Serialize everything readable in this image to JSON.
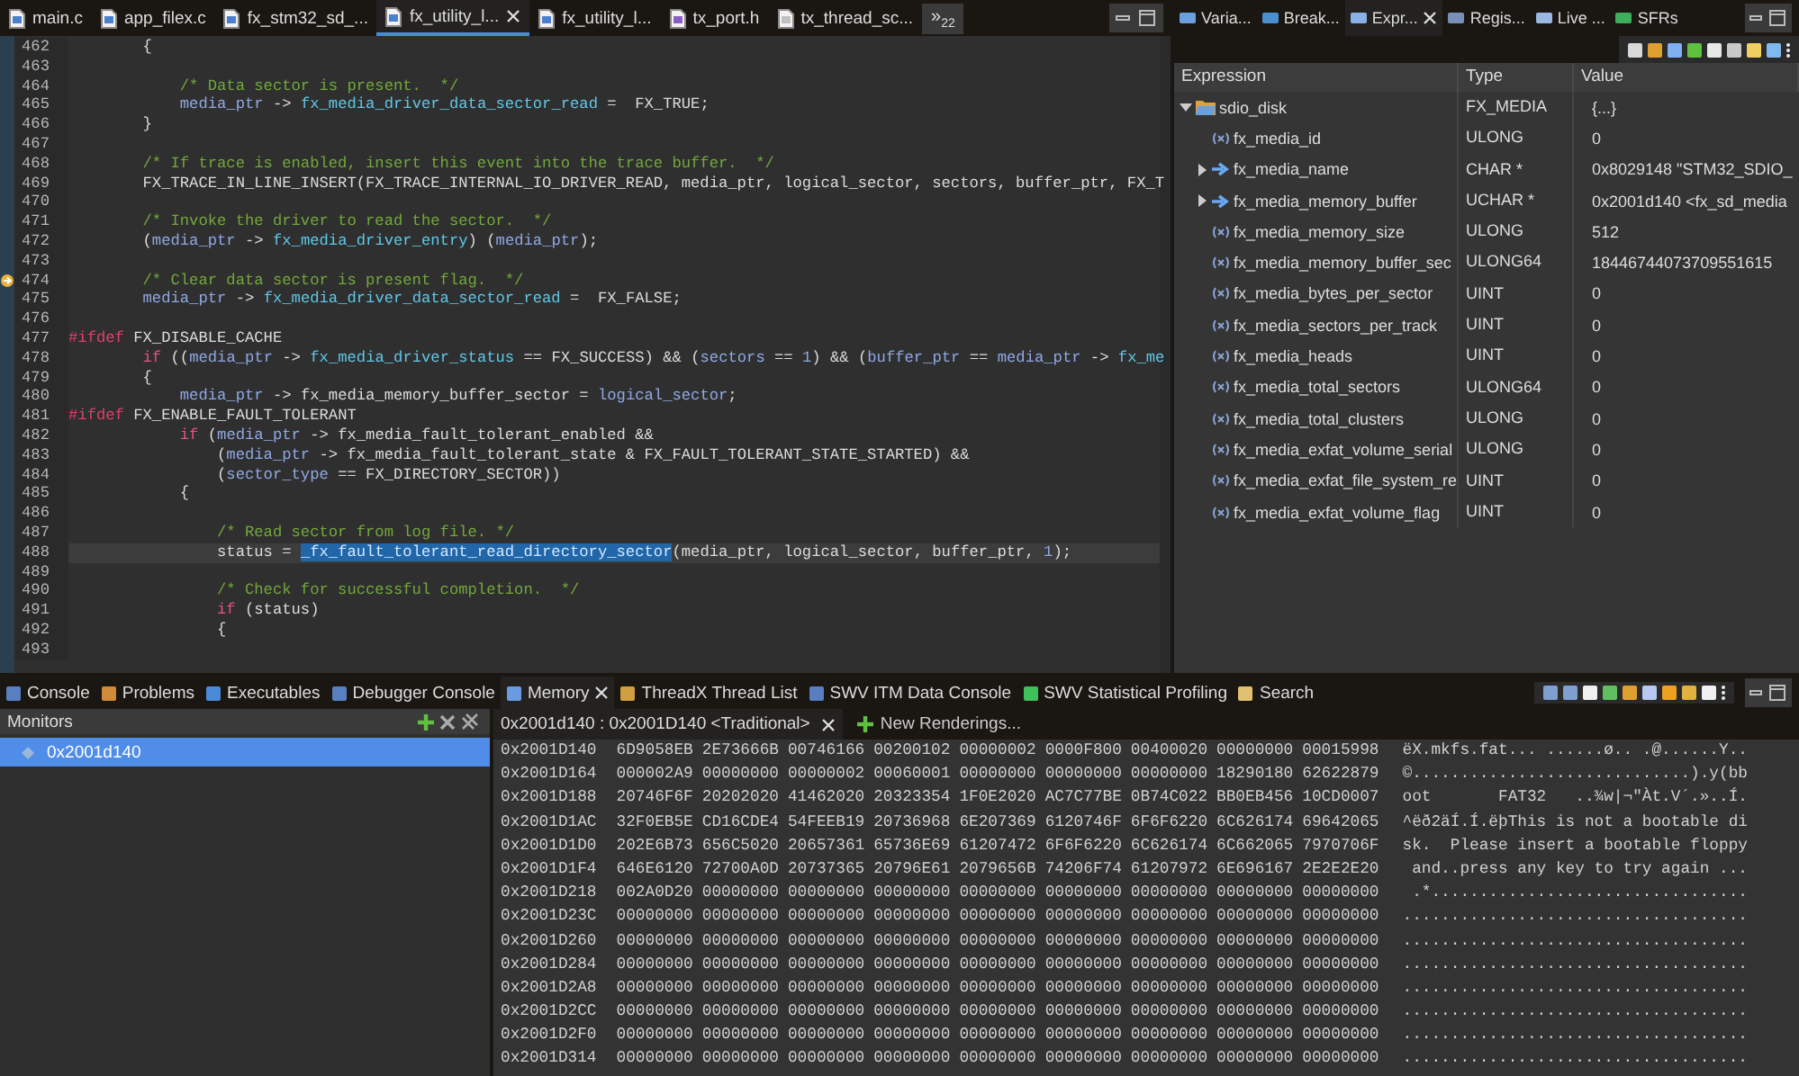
{
  "editor": {
    "tabs": [
      {
        "label": "main.c",
        "kind": "c-source",
        "selected": false
      },
      {
        "label": "app_filex.c",
        "kind": "c-source",
        "selected": false
      },
      {
        "label": "fx_stm32_sd_...",
        "kind": "c-source",
        "selected": false
      },
      {
        "label": "fx_utility_l...",
        "kind": "c-source",
        "selected": true
      },
      {
        "label": "fx_utility_l...",
        "kind": "c-source",
        "selected": false
      },
      {
        "label": "tx_port.h",
        "kind": "c-header",
        "selected": false
      },
      {
        "label": "tx_thread_sc...",
        "kind": "asm-source",
        "selected": false
      }
    ],
    "overflow": {
      "label": "»",
      "count": "22"
    },
    "lines": [
      {
        "number": "462",
        "kind": "plain",
        "segments": [
          {
            "kind": "plain",
            "text": "        {"
          }
        ]
      },
      {
        "number": "463",
        "kind": "plain"
      },
      {
        "number": "464",
        "kind": "plain",
        "segments": [
          {
            "kind": "comment",
            "text": "            /* Data sector is present.  */"
          }
        ]
      },
      {
        "number": "465",
        "kind": "plain",
        "segments": [
          {
            "kind": "var",
            "text": "            media_ptr"
          },
          {
            "kind": "plain",
            "text": " -> "
          },
          {
            "kind": "field",
            "text": "fx_media_driver_data_sector_read"
          },
          {
            "kind": "plain",
            "text": " =  FX_TRUE;"
          }
        ]
      },
      {
        "number": "466",
        "kind": "plain",
        "segments": [
          {
            "kind": "plain",
            "text": "        }"
          }
        ]
      },
      {
        "number": "467",
        "kind": "plain"
      },
      {
        "number": "468",
        "kind": "plain",
        "segments": [
          {
            "kind": "comment",
            "text": "        /* If trace is enabled, insert this event into the trace buffer.  */"
          }
        ]
      },
      {
        "number": "469",
        "kind": "plain",
        "segments": [
          {
            "kind": "plain",
            "text": "        FX_TRACE_IN_LINE_INSERT(FX_TRACE_INTERNAL_IO_DRIVER_READ, media_ptr, logical_sector, sectors, buffer_ptr, FX_T"
          }
        ]
      },
      {
        "number": "470",
        "kind": "plain"
      },
      {
        "number": "471",
        "kind": "plain",
        "segments": [
          {
            "kind": "comment",
            "text": "        /* Invoke the driver to read the sector.  */"
          }
        ]
      },
      {
        "number": "472",
        "kind": "plain",
        "segments": [
          {
            "kind": "plain",
            "text": "        ("
          },
          {
            "kind": "var",
            "text": "media_ptr"
          },
          {
            "kind": "plain",
            "text": " -> "
          },
          {
            "kind": "field",
            "text": "fx_media_driver_entry"
          },
          {
            "kind": "plain",
            "text": ") ("
          },
          {
            "kind": "var",
            "text": "media_ptr"
          },
          {
            "kind": "plain",
            "text": ");"
          }
        ]
      },
      {
        "number": "473",
        "kind": "plain"
      },
      {
        "number": "474",
        "kind": "pointer",
        "segments": [
          {
            "kind": "comment",
            "text": "        /* Clear data sector is present flag.  */"
          }
        ]
      },
      {
        "number": "475",
        "kind": "plain",
        "segments": [
          {
            "kind": "var",
            "text": "        media_ptr"
          },
          {
            "kind": "plain",
            "text": " -> "
          },
          {
            "kind": "field",
            "text": "fx_media_driver_data_sector_read"
          },
          {
            "kind": "plain",
            "text": " =  FX_FALSE;"
          }
        ]
      },
      {
        "number": "476",
        "kind": "plain"
      },
      {
        "number": "477",
        "kind": "plain",
        "segments": [
          {
            "kind": "directive",
            "text": "#ifdef"
          },
          {
            "kind": "plain",
            "text": " FX_DISABLE_CACHE"
          }
        ]
      },
      {
        "number": "478",
        "kind": "plain",
        "segments": [
          {
            "kind": "keyword",
            "text": "        if"
          },
          {
            "kind": "plain",
            "text": " (("
          },
          {
            "kind": "var",
            "text": "media_ptr"
          },
          {
            "kind": "plain",
            "text": " -> "
          },
          {
            "kind": "field",
            "text": "fx_media_driver_status"
          },
          {
            "kind": "plain",
            "text": " == FX_SUCCESS) && ("
          },
          {
            "kind": "var",
            "text": "sectors"
          },
          {
            "kind": "plain",
            "text": " == "
          },
          {
            "kind": "number",
            "text": "1"
          },
          {
            "kind": "plain",
            "text": ") && ("
          },
          {
            "kind": "var",
            "text": "buffer_ptr"
          },
          {
            "kind": "plain",
            "text": " == "
          },
          {
            "kind": "var",
            "text": "media_ptr"
          },
          {
            "kind": "plain",
            "text": " -> "
          },
          {
            "kind": "field",
            "text": "fx_me"
          }
        ]
      },
      {
        "number": "479",
        "kind": "plain",
        "segments": [
          {
            "kind": "plain",
            "text": "        {"
          }
        ]
      },
      {
        "number": "480",
        "kind": "plain",
        "segments": [
          {
            "kind": "var",
            "text": "            media_ptr"
          },
          {
            "kind": "plain",
            "text": " -> fx_media_memory_buffer_sector = "
          },
          {
            "kind": "var",
            "text": "logical_sector"
          },
          {
            "kind": "plain",
            "text": ";"
          }
        ]
      },
      {
        "number": "481",
        "kind": "plain",
        "segments": [
          {
            "kind": "directive",
            "text": "#ifdef"
          },
          {
            "kind": "plain",
            "text": " FX_ENABLE_FAULT_TOLERANT"
          }
        ]
      },
      {
        "number": "482",
        "kind": "plain",
        "segments": [
          {
            "kind": "keyword",
            "text": "            if"
          },
          {
            "kind": "plain",
            "text": " ("
          },
          {
            "kind": "var",
            "text": "media_ptr"
          },
          {
            "kind": "plain",
            "text": " -> fx_media_fault_tolerant_enabled &&"
          }
        ]
      },
      {
        "number": "483",
        "kind": "plain",
        "segments": [
          {
            "kind": "plain",
            "text": "                ("
          },
          {
            "kind": "var",
            "text": "media_ptr"
          },
          {
            "kind": "plain",
            "text": " -> fx_media_fault_tolerant_state & FX_FAULT_TOLERANT_STATE_STARTED) &&"
          }
        ]
      },
      {
        "number": "484",
        "kind": "plain",
        "segments": [
          {
            "kind": "plain",
            "text": "                ("
          },
          {
            "kind": "var",
            "text": "sector_type"
          },
          {
            "kind": "plain",
            "text": " == FX_DIRECTORY_SECTOR))"
          }
        ]
      },
      {
        "number": "485",
        "kind": "plain",
        "segments": [
          {
            "kind": "plain",
            "text": "            {"
          }
        ]
      },
      {
        "number": "486",
        "kind": "plain"
      },
      {
        "number": "487",
        "kind": "plain",
        "segments": [
          {
            "kind": "comment",
            "text": "                /* Read sector from log file. */"
          }
        ]
      },
      {
        "number": "488",
        "kind": "current",
        "segments": [
          {
            "kind": "plain",
            "text": "                status = "
          },
          {
            "kind": "selection",
            "text": "_fx_fault_tolerant_read_directory_sector"
          },
          {
            "kind": "plain",
            "text": "(media_ptr, logical_sector, buffer_ptr, "
          },
          {
            "kind": "number",
            "text": "1"
          },
          {
            "kind": "plain",
            "text": ");"
          }
        ]
      },
      {
        "number": "489",
        "kind": "plain"
      },
      {
        "number": "490",
        "kind": "plain",
        "segments": [
          {
            "kind": "comment",
            "text": "                /* Check for successful completion.  */"
          }
        ]
      },
      {
        "number": "491",
        "kind": "plain",
        "segments": [
          {
            "kind": "keyword",
            "text": "                if"
          },
          {
            "kind": "plain",
            "text": " (status)"
          }
        ]
      },
      {
        "number": "492",
        "kind": "plain",
        "segments": [
          {
            "kind": "plain",
            "text": "                {"
          }
        ]
      },
      {
        "number": "493",
        "kind": "plain"
      }
    ]
  },
  "debug_panel": {
    "tabs": [
      {
        "label": "Varia...",
        "kind": "variables",
        "selected": false
      },
      {
        "label": "Break...",
        "kind": "breakpoints",
        "selected": false
      },
      {
        "label": "Expr...",
        "kind": "expressions",
        "selected": true
      },
      {
        "label": "Regis...",
        "kind": "registers",
        "selected": false
      },
      {
        "label": "Live ...",
        "kind": "live",
        "selected": false
      },
      {
        "label": "SFRs",
        "kind": "sfrs",
        "selected": false
      }
    ],
    "columns": [
      "Expression",
      "Type",
      "Value"
    ],
    "rows": [
      {
        "name": "sdio_disk",
        "type": "FX_MEDIA",
        "value": "{...}",
        "kind": "struct",
        "expanded": true,
        "children": [
          {
            "name": "fx_media_id",
            "type": "ULONG",
            "value": "0",
            "kind": "field"
          },
          {
            "name": "fx_media_name",
            "type": "CHAR *",
            "value": "0x8029148 \"STM32_SDIO_",
            "kind": "pointer",
            "expanded": false
          },
          {
            "name": "fx_media_memory_buffer",
            "type": "UCHAR *",
            "value": "0x2001d140 <fx_sd_media",
            "kind": "pointer",
            "expanded": false
          },
          {
            "name": "fx_media_memory_size",
            "type": "ULONG",
            "value": "512",
            "kind": "field"
          },
          {
            "name": "fx_media_memory_buffer_sec",
            "type": "ULONG64",
            "value": "18446744073709551615",
            "kind": "field"
          },
          {
            "name": "fx_media_bytes_per_sector",
            "type": "UINT",
            "value": "0",
            "kind": "field"
          },
          {
            "name": "fx_media_sectors_per_track",
            "type": "UINT",
            "value": "0",
            "kind": "field"
          },
          {
            "name": "fx_media_heads",
            "type": "UINT",
            "value": "0",
            "kind": "field"
          },
          {
            "name": "fx_media_total_sectors",
            "type": "ULONG64",
            "value": "0",
            "kind": "field"
          },
          {
            "name": "fx_media_total_clusters",
            "type": "ULONG",
            "value": "0",
            "kind": "field"
          },
          {
            "name": "fx_media_exfat_volume_serial",
            "type": "ULONG",
            "value": "0",
            "kind": "field"
          },
          {
            "name": "fx_media_exfat_file_system_re",
            "type": "UINT",
            "value": "0",
            "kind": "field"
          },
          {
            "name": "fx_media_exfat_volume_flag",
            "type": "UINT",
            "value": "0",
            "kind": "field"
          }
        ]
      }
    ]
  },
  "bottom_panel": {
    "tabs": [
      {
        "label": "Console",
        "kind": "console",
        "selected": false
      },
      {
        "label": "Problems",
        "kind": "problems",
        "selected": false
      },
      {
        "label": "Executables",
        "kind": "executables",
        "selected": false
      },
      {
        "label": "Debugger Console",
        "kind": "console",
        "selected": false
      },
      {
        "label": "Memory",
        "kind": "memory",
        "selected": true
      },
      {
        "label": "ThreadX Thread List",
        "kind": "threads",
        "selected": false
      },
      {
        "label": "SWV ITM Data Console",
        "kind": "console",
        "selected": false
      },
      {
        "label": "SWV Statistical Profiling",
        "kind": "profiling",
        "selected": false
      },
      {
        "label": "Search",
        "kind": "search",
        "selected": false
      }
    ],
    "monitors": {
      "title": "Monitors",
      "items": [
        {
          "label": "0x2001d140",
          "selected": true
        }
      ]
    },
    "renderings": {
      "tabs": [
        {
          "label": "0x2001d140 : 0x2001D140 <Traditional>",
          "selected": true
        }
      ],
      "new_rendering": "New Renderings..."
    },
    "memory_rows": [
      {
        "address": "0x2001D140",
        "words": [
          "6D9058EB",
          "2E73666B",
          "00746166",
          "00200102",
          "00000002",
          "0000F800",
          "00400020",
          "00000000",
          "00015998"
        ],
        "ascii": "ëX.mkfs.fat... ......ø.. .@......Y.."
      },
      {
        "address": "0x2001D164",
        "words": [
          "000002A9",
          "00000000",
          "00000002",
          "00060001",
          "00000000",
          "00000000",
          "00000000",
          "18290180",
          "62622879"
        ],
        "ascii": "©.............................).y(bb"
      },
      {
        "address": "0x2001D188",
        "words": [
          "20746F6F",
          "20202020",
          "41462020",
          "20323354",
          "1F0E2020",
          "AC7C77BE",
          "0B74C022",
          "BB0EB456",
          "10CD0007"
        ],
        "ascii": "oot       FAT32   ..¾w|¬\"Àt.V´.»..Í."
      },
      {
        "address": "0x2001D1AC",
        "words": [
          "32F0EB5E",
          "CD16CDE4",
          "54FEEB19",
          "20736968",
          "6E207369",
          "6120746F",
          "6F6F6220",
          "6C626174",
          "69642065"
        ],
        "ascii": "^ëð2äÍ.Í.ëþThis is not a bootable di"
      },
      {
        "address": "0x2001D1D0",
        "words": [
          "202E6B73",
          "656C5020",
          "20657361",
          "65736E69",
          "61207472",
          "6F6F6220",
          "6C626174",
          "6C662065",
          "7970706F"
        ],
        "ascii": "sk.  Please insert a bootable floppy"
      },
      {
        "address": "0x2001D1F4",
        "words": [
          "646E6120",
          "72700A0D",
          "20737365",
          "20796E61",
          "2079656B",
          "74206F74",
          "61207972",
          "6E696167",
          "2E2E2E20"
        ],
        "ascii": " and..press any key to try again ..."
      },
      {
        "address": "0x2001D218",
        "words": [
          "002A0D20",
          "00000000",
          "00000000",
          "00000000",
          "00000000",
          "00000000",
          "00000000",
          "00000000",
          "00000000"
        ],
        "ascii": " .*................................."
      },
      {
        "address": "0x2001D23C",
        "words": [
          "00000000",
          "00000000",
          "00000000",
          "00000000",
          "00000000",
          "00000000",
          "00000000",
          "00000000",
          "00000000"
        ],
        "ascii": "...................................."
      },
      {
        "address": "0x2001D260",
        "words": [
          "00000000",
          "00000000",
          "00000000",
          "00000000",
          "00000000",
          "00000000",
          "00000000",
          "00000000",
          "00000000"
        ],
        "ascii": "...................................."
      },
      {
        "address": "0x2001D284",
        "words": [
          "00000000",
          "00000000",
          "00000000",
          "00000000",
          "00000000",
          "00000000",
          "00000000",
          "00000000",
          "00000000"
        ],
        "ascii": "...................................."
      },
      {
        "address": "0x2001D2A8",
        "words": [
          "00000000",
          "00000000",
          "00000000",
          "00000000",
          "00000000",
          "00000000",
          "00000000",
          "00000000",
          "00000000"
        ],
        "ascii": "...................................."
      },
      {
        "address": "0x2001D2CC",
        "words": [
          "00000000",
          "00000000",
          "00000000",
          "00000000",
          "00000000",
          "00000000",
          "00000000",
          "00000000",
          "00000000"
        ],
        "ascii": "...................................."
      },
      {
        "address": "0x2001D2F0",
        "words": [
          "00000000",
          "00000000",
          "00000000",
          "00000000",
          "00000000",
          "00000000",
          "00000000",
          "00000000",
          "00000000"
        ],
        "ascii": "...................................."
      },
      {
        "address": "0x2001D314",
        "words": [
          "00000000",
          "00000000",
          "00000000",
          "00000000",
          "00000000",
          "00000000",
          "00000000",
          "00000000",
          "00000000"
        ],
        "ascii": "...................................."
      }
    ]
  }
}
